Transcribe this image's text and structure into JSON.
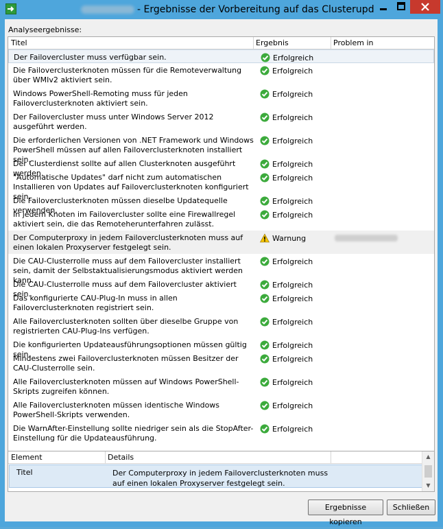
{
  "window": {
    "title": "- Ergebnisse der Vorbereitung auf das Clusterupdate"
  },
  "colors": {
    "accent": "#4ea6dc",
    "close": "#c7392d",
    "ok": "#3caa3c",
    "warning": "#f5c400"
  },
  "labels": {
    "analyse": "Analyseergebnisse:"
  },
  "grid": {
    "headers": {
      "titel": "Titel",
      "ergebnis": "Ergebnis",
      "problem": "Problem in"
    },
    "rows": [
      {
        "titel": "Der Failovercluster muss verfügbar sein.",
        "ergebnis": "Erfolgreich",
        "status": "ok"
      },
      {
        "titel": "Die Failoverclusterknoten müssen für die Remoteverwaltung über WMIv2 aktiviert sein.",
        "ergebnis": "Erfolgreich",
        "status": "ok"
      },
      {
        "titel": "Windows PowerShell-Remoting muss für jeden Failoverclusterknoten aktiviert sein.",
        "ergebnis": "Erfolgreich",
        "status": "ok"
      },
      {
        "titel": "Der Failovercluster muss unter Windows Server 2012 ausgeführt werden.",
        "ergebnis": "Erfolgreich",
        "status": "ok"
      },
      {
        "titel": "Die erforderlichen Versionen von .NET Framework und Windows PowerShell müssen auf allen Failoverclusterknoten installiert sein.",
        "ergebnis": "Erfolgreich",
        "status": "ok"
      },
      {
        "titel": "Der Clusterdienst sollte auf allen Clusterknoten ausgeführt werden.",
        "ergebnis": "Erfolgreich",
        "status": "ok"
      },
      {
        "titel": "\"Automatische Updates\" darf nicht zum automatischen Installieren von Updates auf Failoverclusterknoten konfiguriert sein.",
        "ergebnis": "Erfolgreich",
        "status": "ok"
      },
      {
        "titel": "Die Failoverclusterknoten müssen dieselbe Updatequelle verwenden.",
        "ergebnis": "Erfolgreich",
        "status": "ok"
      },
      {
        "titel": "In jedem Knoten im Failovercluster sollte eine Firewallregel aktiviert sein, die das Remoteherunterfahren zulässt.",
        "ergebnis": "Erfolgreich",
        "status": "ok"
      },
      {
        "titel": "Der Computerproxy in jedem Failoverclusterknoten muss auf einen lokalen Proxyserver festgelegt sein.",
        "ergebnis": "Warnung",
        "status": "warn"
      },
      {
        "titel": "Die CAU-Clusterrolle muss auf dem Failovercluster installiert sein, damit der Selbstaktualisierungsmodus aktiviert werden kann.",
        "ergebnis": "Erfolgreich",
        "status": "ok"
      },
      {
        "titel": "Die CAU-Clusterrolle muss auf dem Failovercluster aktiviert sein.",
        "ergebnis": "Erfolgreich",
        "status": "ok"
      },
      {
        "titel": "Das konfigurierte CAU-Plug-In muss in allen Failoverclusterknoten registriert sein.",
        "ergebnis": "Erfolgreich",
        "status": "ok"
      },
      {
        "titel": "Alle Failoverclusterknoten sollten über dieselbe Gruppe von registrierten CAU-Plug-Ins verfügen.",
        "ergebnis": "Erfolgreich",
        "status": "ok"
      },
      {
        "titel": "Die konfigurierten Updateausführungsoptionen müssen gültig sein.",
        "ergebnis": "Erfolgreich",
        "status": "ok"
      },
      {
        "titel": "Mindestens zwei Failoverclusterknoten müssen Besitzer der CAU-Clusterrolle sein.",
        "ergebnis": "Erfolgreich",
        "status": "ok"
      },
      {
        "titel": "Alle Failoverclusterknoten müssen auf Windows PowerShell-Skripts zugreifen können.",
        "ergebnis": "Erfolgreich",
        "status": "ok"
      },
      {
        "titel": "Alle Failoverclusterknoten müssen identische Windows PowerShell-Skripts verwenden.",
        "ergebnis": "Erfolgreich",
        "status": "ok"
      },
      {
        "titel": "Die WarnAfter-Einstellung sollte niedriger sein als die StopAfter-Einstellung für die Updateausführung.",
        "ergebnis": "Erfolgreich",
        "status": "ok"
      }
    ]
  },
  "details": {
    "headers": {
      "element": "Element",
      "details": "Details"
    },
    "row": {
      "key": "Titel",
      "value": "Der Computerproxy in jedem Failoverclusterknoten muss auf einen lokalen Proxyserver festgelegt sein."
    }
  },
  "buttons": {
    "copy": "Ergebnisse kopieren",
    "close": "Schließen"
  }
}
